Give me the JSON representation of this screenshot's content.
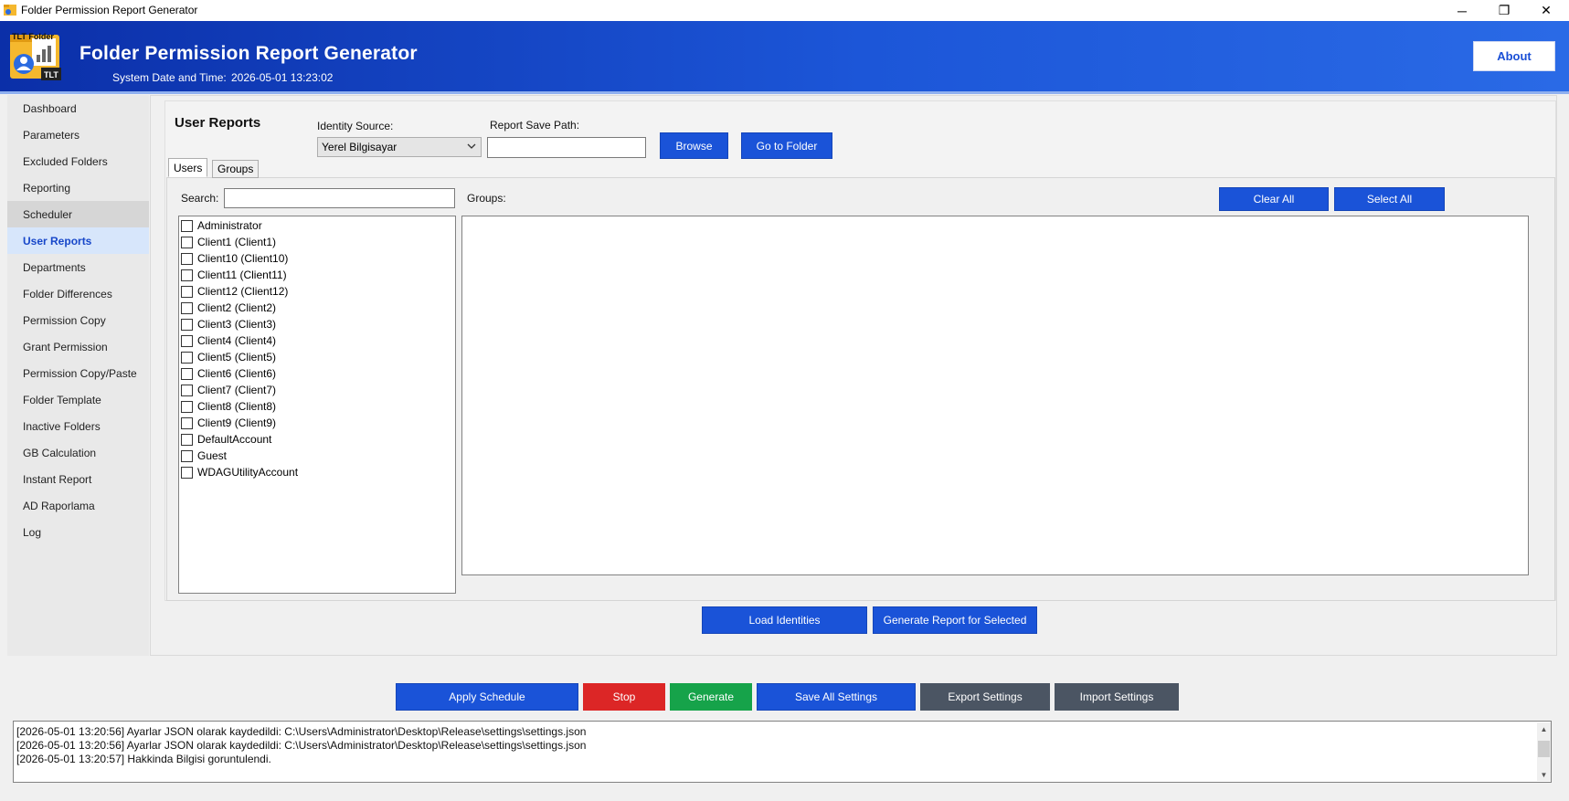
{
  "window": {
    "title": "Folder Permission Report Generator",
    "controls": {
      "minimize": "─",
      "restore": "❐",
      "close": "✕"
    }
  },
  "header": {
    "title": "Folder Permission Report Generator",
    "datetime_label": "System Date and Time:",
    "datetime_value": "2026-05-01 13:23:02",
    "about_label": "About",
    "logo": {
      "top_text": "TLT Folder",
      "badge_text": "TLT",
      "icon": "folder-user-chart-icon"
    }
  },
  "sidebar": {
    "items": [
      {
        "label": "Dashboard"
      },
      {
        "label": "Parameters"
      },
      {
        "label": "Excluded Folders"
      },
      {
        "label": "Reporting"
      },
      {
        "label": "Scheduler"
      },
      {
        "label": "User Reports"
      },
      {
        "label": "Departments"
      },
      {
        "label": "Folder Differences"
      },
      {
        "label": "Permission Copy"
      },
      {
        "label": "Grant Permission"
      },
      {
        "label": "Permission Copy/Paste"
      },
      {
        "label": "Folder Template"
      },
      {
        "label": "Inactive Folders"
      },
      {
        "label": "GB Calculation"
      },
      {
        "label": "Instant Report"
      },
      {
        "label": "AD Raporlama"
      },
      {
        "label": "Log"
      }
    ],
    "active": "User Reports"
  },
  "user_reports": {
    "title": "User Reports",
    "identity_source_label": "Identity Source:",
    "identity_source_value": "Yerel Bilgisayar",
    "report_save_path_label": "Report Save Path:",
    "report_save_path_value": "",
    "browse_label": "Browse",
    "go_to_folder_label": "Go to Folder",
    "tabs": [
      {
        "label": "Users"
      },
      {
        "label": "Groups"
      }
    ],
    "search_label": "Search:",
    "search_value": "",
    "groups_label": "Groups:",
    "clear_all_label": "Clear All",
    "select_all_label": "Select All",
    "users": [
      "Administrator",
      "Client1 (Client1)",
      "Client10 (Client10)",
      "Client11 (Client11)",
      "Client12 (Client12)",
      "Client2 (Client2)",
      "Client3 (Client3)",
      "Client4 (Client4)",
      "Client5 (Client5)",
      "Client6 (Client6)",
      "Client7 (Client7)",
      "Client8 (Client8)",
      "Client9 (Client9)",
      "DefaultAccount",
      "Guest",
      "WDAGUtilityAccount"
    ],
    "load_identities_label": "Load Identities",
    "generate_selected_label": "Generate Report for Selected"
  },
  "footer": {
    "apply_schedule_label": "Apply Schedule",
    "stop_label": "Stop",
    "generate_label": "Generate",
    "save_all_label": "Save All Settings",
    "export_label": "Export Settings",
    "import_label": "Import Settings"
  },
  "log": {
    "lines": [
      "[2026-05-01 13:20:56] Ayarlar JSON olarak kaydedildi: C:\\Users\\Administrator\\Desktop\\Release\\settings\\settings.json",
      "[2026-05-01 13:20:56] Ayarlar JSON olarak kaydedildi: C:\\Users\\Administrator\\Desktop\\Release\\settings\\settings.json",
      "[2026-05-01 13:20:57] Hakkinda Bilgisi goruntulendi."
    ]
  },
  "colors": {
    "accent_blue": "#1a53d8",
    "header_start": "#0b2fa8",
    "header_end": "#2a6ae6",
    "stop_red": "#dc2626",
    "generate_green": "#16a34a",
    "settings_gray": "#4b5563"
  }
}
